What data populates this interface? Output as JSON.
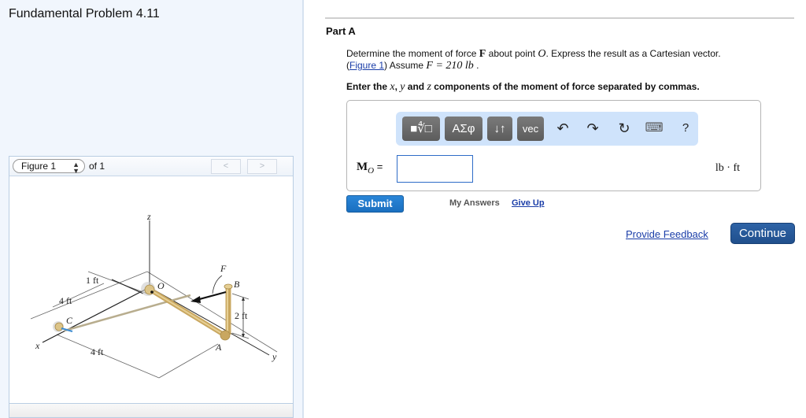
{
  "problem": {
    "title": "Fundamental Problem 4.11"
  },
  "figure": {
    "select_value": "Figure 1",
    "of_label": "of 1",
    "prev_label": "<",
    "next_label": ">",
    "labels": {
      "z": "z",
      "x": "x",
      "y": "y",
      "O": "O",
      "A": "A",
      "B": "B",
      "C": "C",
      "F": "F",
      "dim_1ft": "1 ft",
      "dim_4ft_a": "4 ft",
      "dim_4ft_b": "4 ft",
      "dim_2ft": "2 ft"
    }
  },
  "part": {
    "title": "Part A",
    "question_pre": "Determine the moment of force ",
    "question_F": "F",
    "question_mid": " about point ",
    "question_O": "O",
    "question_post": ". Express the result as a Cartesian vector.",
    "figure_link": "Figure 1",
    "assume_pre": ") Assume ",
    "assume_math": "F = 210 lb",
    "assume_post": " .",
    "instruction_pre": "Enter the ",
    "instruction_x": "x",
    "instruction_comma": ", ",
    "instruction_y": "y",
    "instruction_and": " and ",
    "instruction_z": "z",
    "instruction_post": " components of the moment of force separated by commas."
  },
  "toolbar": {
    "templates": "■∜□",
    "greek": "ΑΣφ",
    "arrows": "↓↑",
    "vec": "vec",
    "undo": "↶",
    "redo": "↷",
    "reset": "↻",
    "keyboard": "⌨",
    "help": "?"
  },
  "answer": {
    "label_main": "M",
    "label_sub": "O",
    "label_eq": " =",
    "value": "",
    "unit": "lb · ft"
  },
  "actions": {
    "submit": "Submit",
    "my_answers": "My Answers",
    "give_up": "Give Up",
    "feedback": "Provide Feedback",
    "continue": "Continue"
  },
  "colors": {
    "link": "#1a3da8",
    "submit": "#1f7ac9",
    "continue": "#2a5a9a",
    "toolbar_bg": "#cfe3fb",
    "left_panel_bg": "#f1f6fd"
  }
}
